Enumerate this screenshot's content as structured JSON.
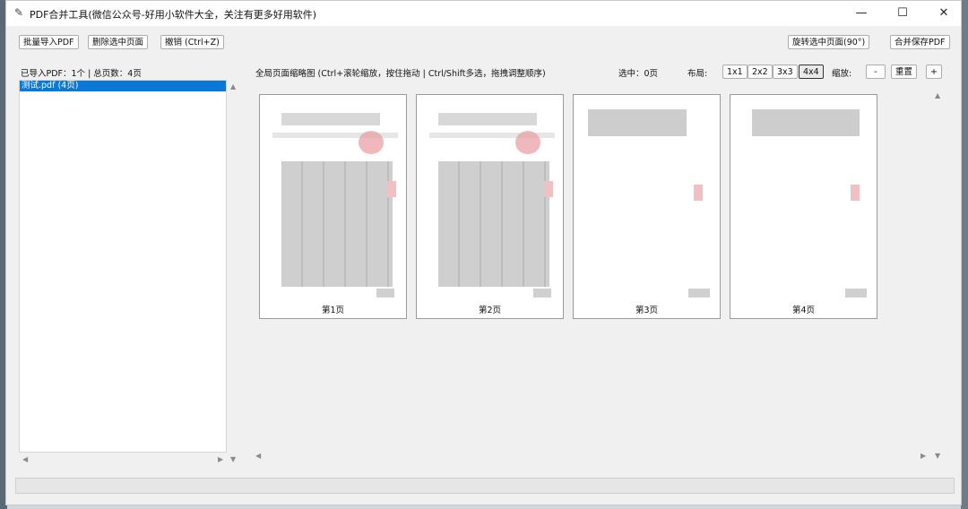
{
  "window": {
    "title": "PDF合并工具(微信公众号-好用小软件大全，关注有更多好用软件)",
    "minimize": "—",
    "maximize": "☐",
    "close": "✕"
  },
  "toolbar": {
    "import_label": "批量导入PDF",
    "delete_label": "删除选中页面",
    "undo_label": "撤销 (Ctrl+Z)",
    "rotate_label": "旋转选中页面(90°)",
    "merge_label": "合并保存PDF"
  },
  "left_panel": {
    "summary": "已导入PDF：1个 | 总页数：4页",
    "files": [
      {
        "name": "测试.pdf (4页)"
      }
    ]
  },
  "thumbnails_header": {
    "hint": "全局页面缩略图 (Ctrl+滚轮缩放，按住拖动 | Ctrl/Shift多选，拖拽调整顺序)",
    "selected": "选中：0页",
    "layout_label": "布局:",
    "layouts": [
      "1x1",
      "2x2",
      "3x3",
      "4x4"
    ],
    "active_layout": "4x4",
    "zoom_label": "缩放:",
    "zoom_out": "-",
    "zoom_reset": "重置",
    "zoom_in": "+"
  },
  "pages": [
    {
      "caption": "第1页"
    },
    {
      "caption": "第2页"
    },
    {
      "caption": "第3页"
    },
    {
      "caption": "第4页"
    }
  ],
  "colors": {
    "selection": "#0a78d7",
    "stamp": "#e89aa0"
  }
}
